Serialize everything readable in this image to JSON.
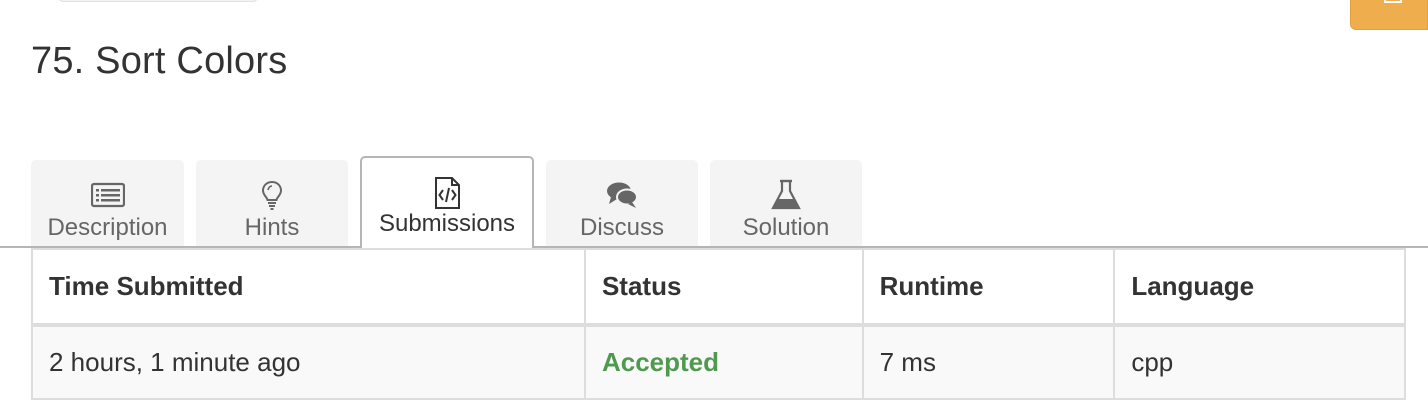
{
  "problem": {
    "title": "75. Sort Colors"
  },
  "tabs": [
    {
      "label": "Description",
      "icon": "list-icon"
    },
    {
      "label": "Hints",
      "icon": "lightbulb-icon"
    },
    {
      "label": "Submissions",
      "icon": "code-file-icon",
      "active": true
    },
    {
      "label": "Discuss",
      "icon": "comments-icon"
    },
    {
      "label": "Solution",
      "icon": "flask-icon"
    }
  ],
  "table": {
    "headers": [
      "Time Submitted",
      "Status",
      "Runtime",
      "Language"
    ],
    "rows": [
      {
        "time": "2 hours, 1 minute ago",
        "status": "Accepted",
        "runtime": "7 ms",
        "language": "cpp"
      }
    ]
  },
  "colors": {
    "accent": "#f0ad4e",
    "status_accepted": "#4f9a4f",
    "tab_inactive": "#f4f4f4"
  }
}
